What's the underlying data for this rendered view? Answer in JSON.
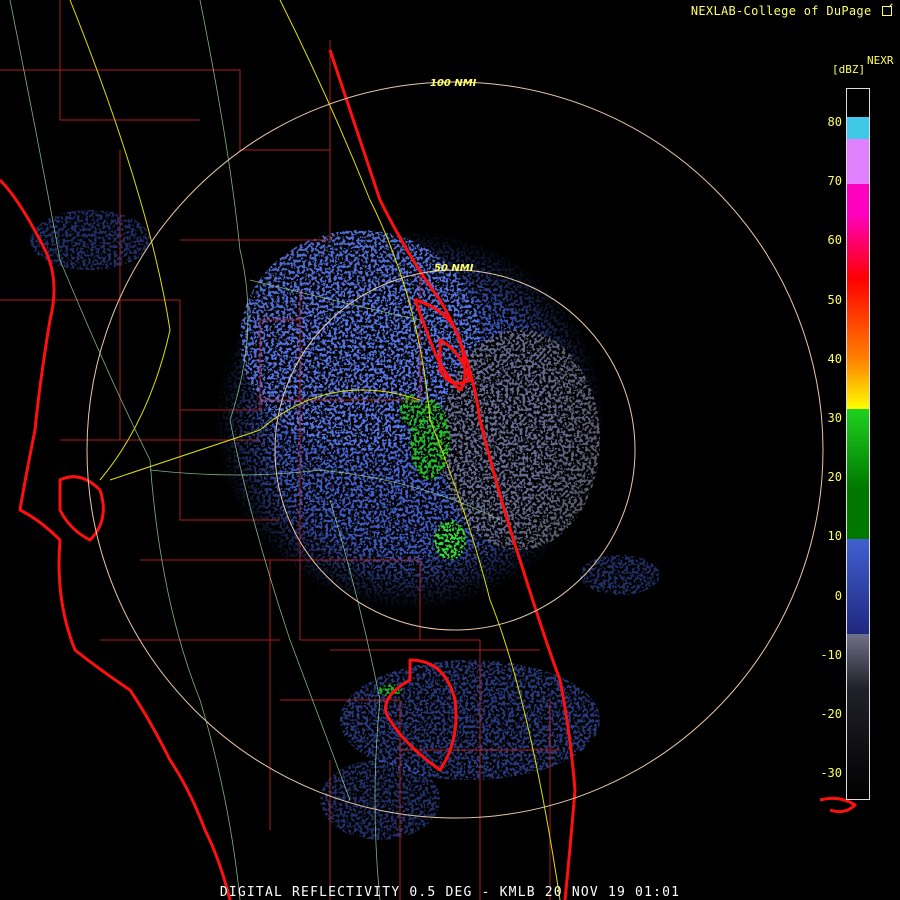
{
  "credit": "NEXLAB-College of DuPage",
  "credit_icon": "external-link-icon",
  "product_label": "NEXR",
  "unit_label": "[dBZ]",
  "legend_ticks": [
    "80",
    "70",
    "60",
    "50",
    "40",
    "30",
    "20",
    "10",
    "0",
    "-10",
    "-20",
    "-30"
  ],
  "legend_colors": {
    "cyan": "#40c8e8",
    "violet": "#e080ff",
    "magenta": "#ff00c0",
    "red": "#ff0000",
    "orange": "#ff8000",
    "yellow": "#ffff00",
    "green": "#20d020",
    "dark_green": "#007800",
    "blue": "#4060d0",
    "navy": "#202880",
    "gray": "#707088",
    "black": "#000000"
  },
  "ring_labels": {
    "inner": "50 NMI",
    "outer": "100 NMI"
  },
  "footer": "DIGITAL REFLECTIVITY 0.5 DEG - KMLB 20 NOV 19 01:01"
}
